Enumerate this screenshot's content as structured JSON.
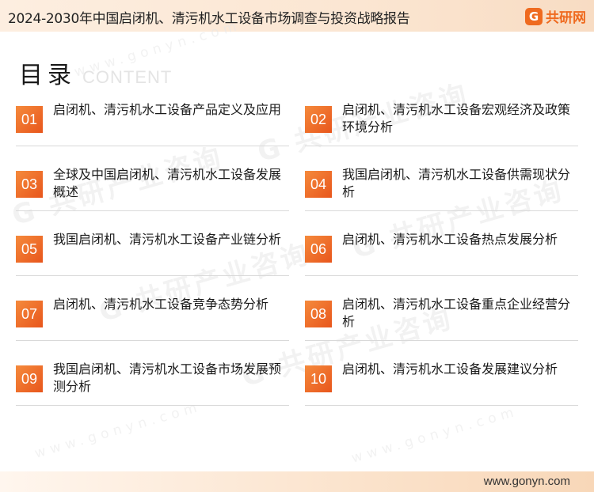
{
  "header": {
    "title": "2024-2030年中国启闭机、清污机水工设备市场调查与投资战略报告",
    "logo_mark": "G",
    "logo_text": "共研网",
    "accent_color": "#ef6a1f"
  },
  "toc": {
    "heading": "目录",
    "heading_sub": "CONTENT",
    "items": [
      {
        "num": "01",
        "label": "启闭机、清污机水工设备产品定义及应用"
      },
      {
        "num": "02",
        "label": "启闭机、清污机水工设备宏观经济及政策环境分析"
      },
      {
        "num": "03",
        "label": "全球及中国启闭机、清污机水工设备发展概述"
      },
      {
        "num": "04",
        "label": "我国启闭机、清污机水工设备供需现状分析"
      },
      {
        "num": "05",
        "label": "我国启闭机、清污机水工设备产业链分析"
      },
      {
        "num": "06",
        "label": "启闭机、清污机水工设备热点发展分析"
      },
      {
        "num": "07",
        "label": "启闭机、清污机水工设备竞争态势分析"
      },
      {
        "num": "08",
        "label": "启闭机、清污机水工设备重点企业经营分析"
      },
      {
        "num": "09",
        "label": "我国启闭机、清污机水工设备市场发展预测分析"
      },
      {
        "num": "10",
        "label": "启闭机、清污机水工设备发展建议分析"
      }
    ]
  },
  "watermark": {
    "brand": "G 共研产业咨询",
    "url": "www.gonyn.com"
  },
  "footer": {
    "url": "www.gonyn.com"
  }
}
